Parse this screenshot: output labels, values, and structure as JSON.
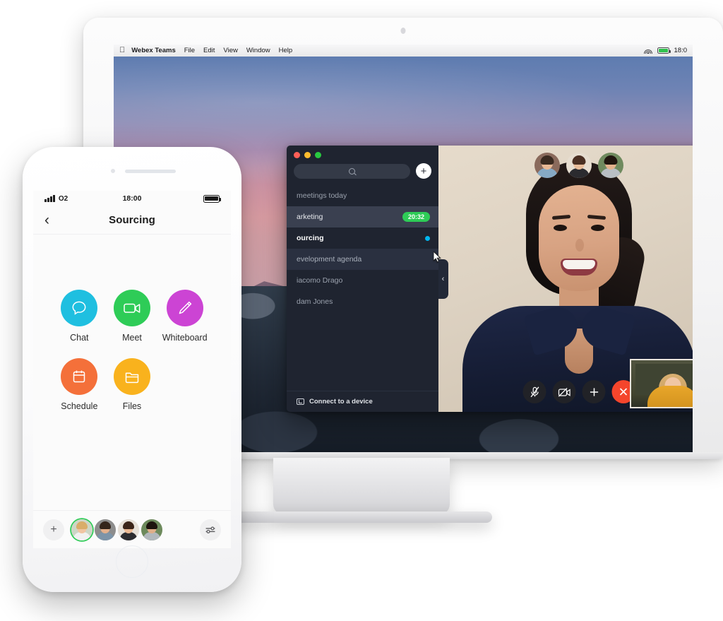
{
  "desktop": {
    "menubar": {
      "apple_icon": "apple-logo-icon",
      "app_name": "Webex Teams",
      "items": [
        "File",
        "Edit",
        "View",
        "Window",
        "Help"
      ],
      "wifi_icon": "wifi-icon",
      "battery_icon": "battery-icon",
      "clock": "18:0"
    }
  },
  "webex_window": {
    "traffic_lights": [
      "close",
      "minimize",
      "zoom"
    ],
    "search": {
      "placeholder": "",
      "icon": "search-icon"
    },
    "add_button_label": "+",
    "spaces": [
      {
        "label": "meetings today",
        "state": "dim",
        "badge": "",
        "unread": false
      },
      {
        "label": "arketing",
        "state": "highlighted",
        "badge": "20:32",
        "unread": false
      },
      {
        "label": "ourcing",
        "state": "active",
        "badge": "",
        "unread": true
      },
      {
        "label": "evelopment agenda",
        "state": "sub",
        "badge": "",
        "unread": false
      },
      {
        "label": "iacomo Drago",
        "state": "dim",
        "badge": "",
        "unread": false
      },
      {
        "label": "dam Jones",
        "state": "dim",
        "badge": "",
        "unread": false
      }
    ],
    "footer": {
      "label": "Connect to a device",
      "icon": "cast-icon"
    },
    "colors": {
      "sidebar_bg": "#1f2430",
      "badge_green": "#2ecc57",
      "unread_blue": "#00b6f0",
      "end_call_red": "#f4452c"
    }
  },
  "video_call": {
    "collapse_tab_icon": "chevron-left-icon",
    "participants": [
      {
        "name": "participant-1"
      },
      {
        "name": "participant-2"
      },
      {
        "name": "participant-3"
      }
    ],
    "controls": [
      {
        "name": "mute-microphone-button",
        "icon": "microphone-muted-icon"
      },
      {
        "name": "stop-video-button",
        "icon": "camera-muted-icon"
      },
      {
        "name": "add-participant-button",
        "icon": "plus-icon"
      },
      {
        "name": "end-call-button",
        "icon": "close-icon"
      }
    ],
    "selfview_label": "self-view"
  },
  "phone": {
    "status": {
      "signal_icon": "signal-bars-icon",
      "carrier": "O2",
      "time": "18:00",
      "battery_icon": "battery-icon"
    },
    "nav": {
      "back_icon": "chevron-left-icon",
      "title": "Sourcing"
    },
    "actions": [
      {
        "label": "Chat",
        "icon": "chat-bubble-icon",
        "color": "#1fbfe0"
      },
      {
        "label": "Meet",
        "icon": "video-camera-icon",
        "color": "#2ecc57"
      },
      {
        "label": "Whiteboard",
        "icon": "pencil-icon",
        "color": "#cc44d4"
      },
      {
        "label": "Schedule",
        "icon": "calendar-icon",
        "color": "#f4703a"
      },
      {
        "label": "Files",
        "icon": "folder-icon",
        "color": "#f9b21d"
      }
    ],
    "bottom_bar": {
      "add_label": "+",
      "filter_icon": "filter-sliders-icon",
      "members": [
        {
          "name": "member-1",
          "active": true
        },
        {
          "name": "member-2",
          "active": false
        },
        {
          "name": "member-3",
          "active": false
        },
        {
          "name": "member-4",
          "active": false
        }
      ]
    }
  }
}
